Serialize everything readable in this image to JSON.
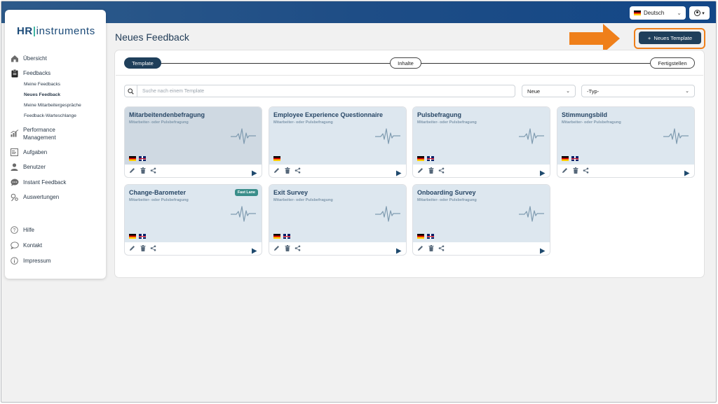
{
  "header": {
    "language": "Deutsch",
    "user_menu_icon": "user-circle-icon"
  },
  "sidebar": {
    "logo": {
      "part1": "HR",
      "part2": "instruments"
    },
    "items": [
      {
        "label": "Übersicht",
        "icon": "home-icon"
      },
      {
        "label": "Feedbacks",
        "icon": "clipboard-icon"
      },
      {
        "label": "Meine Feedbacks",
        "sub": true
      },
      {
        "label": "Neues Feedback",
        "sub": true,
        "active": true
      },
      {
        "label": "Meine Mitarbeitergespräche",
        "sub": true
      },
      {
        "label": "Feedback-Warteschlange",
        "sub": true
      },
      {
        "label": "Performance",
        "label2": "Management",
        "icon": "chart-icon"
      },
      {
        "label": "Aufgaben",
        "icon": "tasks-icon"
      },
      {
        "label": "Benutzer",
        "icon": "user-icon"
      },
      {
        "label": "Instant Feedback",
        "icon": "chat-bubble-icon"
      },
      {
        "label": "Auswertungen",
        "icon": "analytics-icon"
      }
    ],
    "footer": [
      {
        "label": "Hilfe",
        "icon": "help-icon"
      },
      {
        "label": "Kontakt",
        "icon": "contact-bubble-icon"
      },
      {
        "label": "Impressum",
        "icon": "info-icon"
      }
    ]
  },
  "main": {
    "title": "Neues Feedback",
    "new_template_button": "Neues Template",
    "steps": [
      "Template",
      "Inhalte",
      "Fertigstellen"
    ],
    "search_placeholder": "Suche nach einem Template",
    "sort_select": "Neue",
    "type_select": "-Typ-",
    "templates": [
      {
        "title": "Mitarbeitendenbefragung",
        "subtitle": "Mitarbeiter- oder Pulsbefragung",
        "flags": [
          "de",
          "uk"
        ],
        "badge": ""
      },
      {
        "title": "Employee Experience Questionnaire",
        "subtitle": "Mitarbeiter- oder Pulsbefragung",
        "flags": [
          "de"
        ],
        "badge": ""
      },
      {
        "title": "Pulsbefragung",
        "subtitle": "Mitarbeiter- oder Pulsbefragung",
        "flags": [
          "de",
          "uk"
        ],
        "badge": ""
      },
      {
        "title": "Stimmungsbild",
        "subtitle": "Mitarbeiter- oder Pulsbefragung",
        "flags": [
          "de",
          "uk"
        ],
        "badge": ""
      },
      {
        "title": "Change-Barometer",
        "subtitle": "Mitarbeiter- oder Pulsbefragung",
        "flags": [
          "de",
          "uk"
        ],
        "badge": "Fast Lane"
      },
      {
        "title": "Exit Survey",
        "subtitle": "Mitarbeiter- oder Pulsbefragung",
        "flags": [
          "de",
          "uk"
        ],
        "badge": ""
      },
      {
        "title": "Onboarding Survey",
        "subtitle": "Mitarbeiter- oder Pulsbefragung",
        "flags": [
          "de",
          "uk"
        ],
        "badge": ""
      }
    ]
  },
  "colors": {
    "primary": "#1f3f5b",
    "accent_orange": "#ef7f1a",
    "topbar": "#1e4d86",
    "card_bg": "#dde7ef",
    "badge": "#3a8e8a"
  }
}
